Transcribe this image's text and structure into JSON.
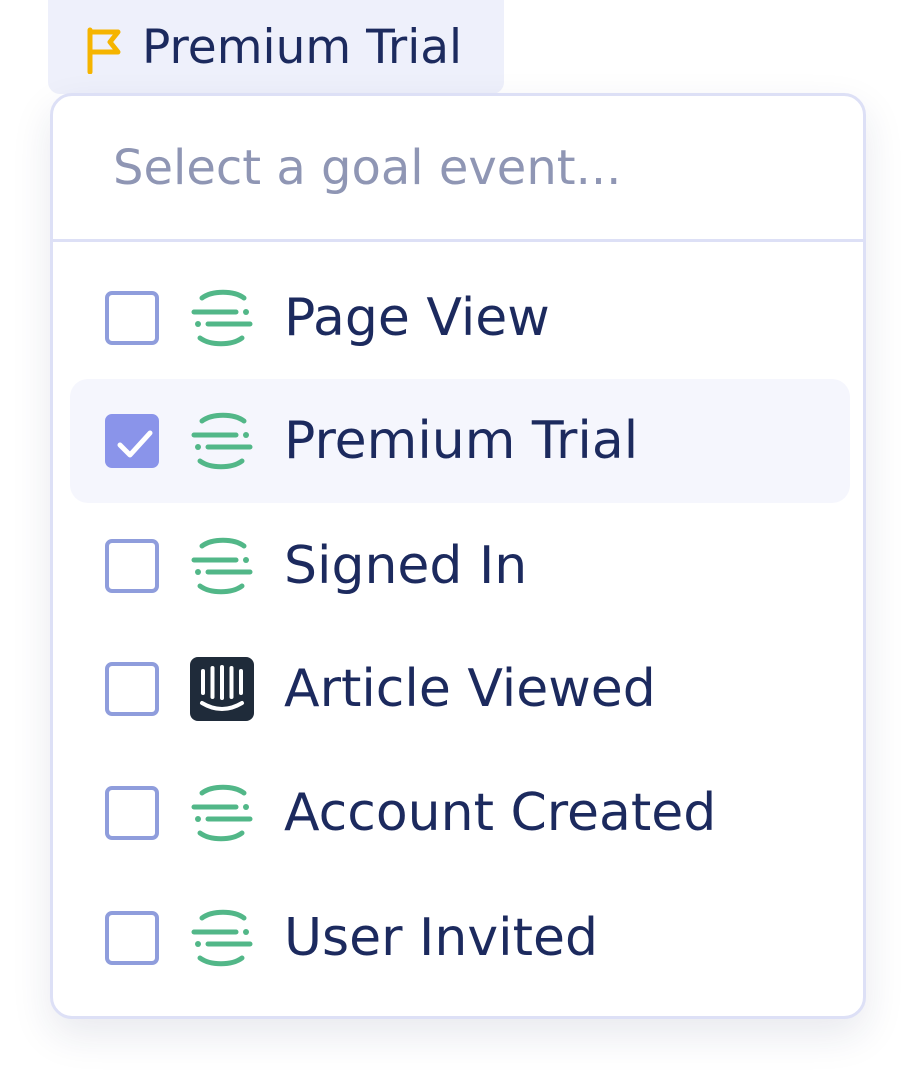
{
  "selected_goal": {
    "label": "Premium Trial",
    "icon": "flag-icon",
    "icon_color": "#f5b400"
  },
  "search": {
    "placeholder": "Select a goal event..."
  },
  "events": [
    {
      "label": "Page View",
      "source_icon": "segment-icon",
      "checked": false
    },
    {
      "label": "Premium Trial",
      "source_icon": "segment-icon",
      "checked": true
    },
    {
      "label": "Signed In",
      "source_icon": "segment-icon",
      "checked": false
    },
    {
      "label": "Article Viewed",
      "source_icon": "intercom-icon",
      "checked": false
    },
    {
      "label": "Account Created",
      "source_icon": "segment-icon",
      "checked": false
    },
    {
      "label": "User Invited",
      "source_icon": "segment-icon",
      "checked": false
    }
  ],
  "colors": {
    "text": "#1c2a5e",
    "placeholder": "#8f96b4",
    "checkbox_border": "#8f9ddc",
    "checkbox_checked": "#8a94ea",
    "segment_green": "#52b788",
    "intercom_dark": "#1f2b3a",
    "selected_row_bg": "#f5f6fd",
    "chip_bg": "#eef0fb"
  }
}
